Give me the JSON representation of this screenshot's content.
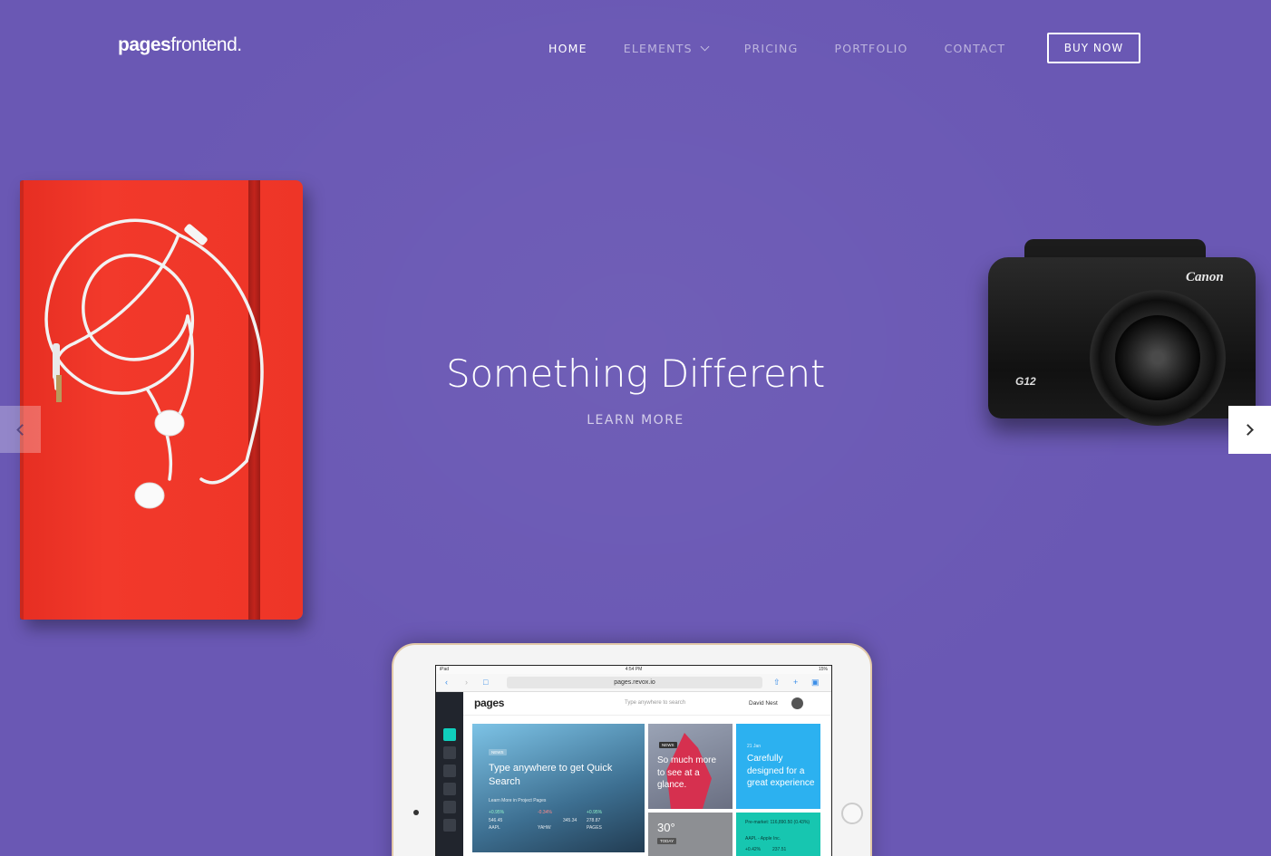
{
  "header": {
    "logo_bold": "pages",
    "logo_light": "frontend.",
    "nav": [
      {
        "label": "HOME",
        "active": true
      },
      {
        "label": "ELEMENTS",
        "dropdown": true
      },
      {
        "label": "PRICING"
      },
      {
        "label": "PORTFOLIO"
      },
      {
        "label": "CONTACT"
      }
    ],
    "buy_label": "BUY NOW"
  },
  "hero": {
    "headline": "Something Different",
    "cta": "LEARN MORE"
  },
  "camera": {
    "brand": "Canon",
    "model": "G12"
  },
  "tablet": {
    "status_left": "iPad",
    "status_time": "4:54 PM",
    "status_right": "15%",
    "url": "pages.revox.io",
    "app_logo": "pages",
    "search_placeholder": "Type anywhere to search",
    "user_name": "David Nest",
    "tile1": {
      "badge": "NEWS",
      "title": "Type anywhere to get Quick Search",
      "subtitle": "Learn More in Project Pages",
      "stats": [
        "+0.95%",
        "-0.34%",
        "+0.95%"
      ],
      "values": [
        "546.45",
        "345.34",
        "278.87"
      ],
      "labels": [
        "AAPL",
        "YAHW",
        "PAGES"
      ]
    },
    "tile2": {
      "badge": "NEWS",
      "title": "So much more to see at a glance."
    },
    "tile3": {
      "date": "21 Jan",
      "title": "Carefully designed for a great experience"
    },
    "tile4": {
      "temp": "30°",
      "label": "TODAY"
    },
    "tile5": {
      "line1": "Pre-market: 116,890.50 (0.43%)",
      "line2": "AAPL - Apple Inc.",
      "line3": "+0.42%",
      "line4": "237.51"
    }
  },
  "colors": {
    "background": "#6a58b4",
    "accent_teal": "#10cfbd",
    "notebook_red": "#ee3527"
  }
}
